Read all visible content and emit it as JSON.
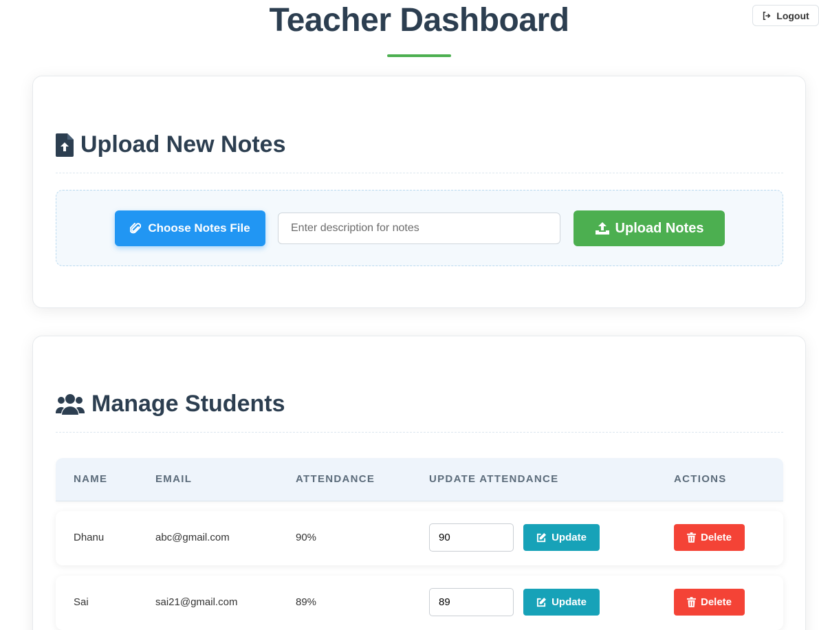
{
  "header": {
    "title": "Teacher Dashboard",
    "logout_label": "Logout"
  },
  "upload": {
    "title": "Upload New Notes",
    "choose_label": "Choose Notes File",
    "description_placeholder": "Enter description for notes",
    "description_value": "",
    "upload_label": "Upload Notes"
  },
  "students": {
    "title": "Manage Students",
    "columns": [
      "NAME",
      "EMAIL",
      "ATTENDANCE",
      "UPDATE ATTENDANCE",
      "ACTIONS"
    ],
    "rows": [
      {
        "name": "Dhanu",
        "email": "abc@gmail.com",
        "attendance": "90%",
        "attendance_input": "90",
        "update_label": "Update",
        "delete_label": "Delete"
      },
      {
        "name": "Sai",
        "email": "sai21@gmail.com",
        "attendance": "89%",
        "attendance_input": "89",
        "update_label": "Update",
        "delete_label": "Delete"
      }
    ]
  },
  "colors": {
    "primary_text": "#2c3e50",
    "accent_green": "#4caf50",
    "accent_blue": "#2196f3",
    "update_teal": "#17a2b8",
    "delete_red": "#f44336"
  },
  "icons": [
    "sign-out-icon",
    "file-upload-icon",
    "paperclip-icon",
    "upload-icon",
    "users-icon",
    "edit-icon",
    "trash-icon"
  ]
}
